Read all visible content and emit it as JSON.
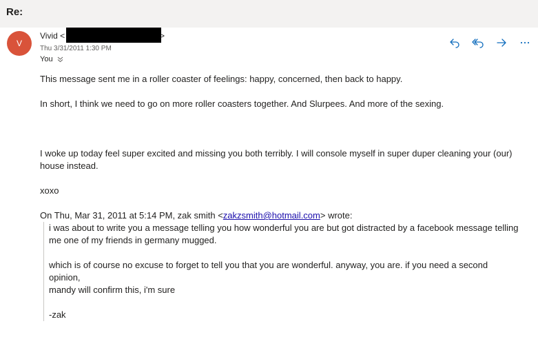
{
  "subject": "Re:",
  "sender": {
    "initial": "V",
    "name": "Vivid",
    "open_bracket": "<",
    "close_bracket": ">",
    "date": "Thu 3/31/2011 1:30 PM",
    "to": "You"
  },
  "colors": {
    "avatar": "#d9533a",
    "accent": "#0f6cbd",
    "link": "#1a0dab"
  },
  "actions": [
    {
      "name": "reply",
      "icon": "reply-icon"
    },
    {
      "name": "reply-all",
      "icon": "reply-all-icon"
    },
    {
      "name": "forward",
      "icon": "forward-icon"
    },
    {
      "name": "more",
      "icon": "more-icon"
    }
  ],
  "body": {
    "p1": "This message sent me in a roller coaster of feelings: happy, concerned, then back to happy.",
    "p2": "In short, I think we need to go on more roller coasters together. And Slurpees. And more of the sexing.",
    "p3": "I woke up today feel super excited and missing you both terribly. I will console myself in super duper cleaning your (our) house instead.",
    "p4": "xoxo",
    "quote_header_prefix": "On Thu, Mar 31, 2011 at 5:14 PM, zak smith <",
    "quote_header_email": "zakzsmith@hotmail.com",
    "quote_header_suffix": "> wrote:"
  },
  "quote": {
    "q1": "i was about to write you a message telling you how wonderful you are but got distracted by a facebook message telling me one of my friends in germany mugged.",
    "q2": "which is of course no excuse to forget to tell you that you are wonderful. anyway, you are. if you need a second opinion,",
    "q3": "mandy will confirm this, i'm sure",
    "q4": "-zak"
  }
}
